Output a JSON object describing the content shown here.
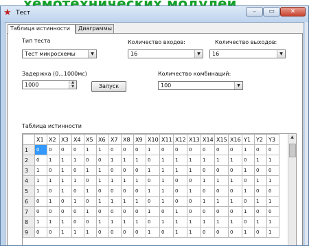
{
  "banner": {
    "text": "хемотехнических модулей"
  },
  "window": {
    "title": "Тест",
    "app_icon": "star-icon",
    "controls": {
      "minimize": "–",
      "maximize": "▭",
      "close": "✕"
    }
  },
  "tabs": [
    {
      "label": "Таблица истинности",
      "active": true
    },
    {
      "label": "Диаграммы",
      "active": false
    }
  ],
  "form": {
    "test_type_label": "Тип теста",
    "test_type_value": "Тест микросхемы",
    "inputs_label": "Количество входов:",
    "inputs_value": "16",
    "outputs_label": "Количество выходов:",
    "outputs_value": "16",
    "delay_label": "Задержка (0...1000мс)",
    "delay_value": "1000",
    "start_label": "Запуск",
    "combinations_label": "Количество комбинаций:",
    "combinations_value": "100"
  },
  "truth_table": {
    "title": "Таблица истинности",
    "columns": [
      "X1",
      "X2",
      "X3",
      "X4",
      "X5",
      "X6",
      "X7",
      "X8",
      "X9",
      "X10",
      "X11",
      "X12",
      "X13",
      "X14",
      "X15",
      "X16",
      "Y1",
      "Y2",
      "Y3"
    ],
    "rows": [
      {
        "n": "1",
        "values": [
          "0",
          "0",
          "0",
          "0",
          "1",
          "1",
          "0",
          "0",
          "0",
          "1",
          "0",
          "0",
          "0",
          "0",
          "0",
          "0",
          "1",
          "0",
          "0"
        ]
      },
      {
        "n": "2",
        "values": [
          "0",
          "1",
          "1",
          "1",
          "0",
          "0",
          "1",
          "1",
          "1",
          "0",
          "1",
          "1",
          "1",
          "1",
          "1",
          "1",
          "0",
          "1",
          "1"
        ]
      },
      {
        "n": "3",
        "values": [
          "1",
          "0",
          "1",
          "0",
          "1",
          "1",
          "0",
          "0",
          "0",
          "1",
          "1",
          "1",
          "1",
          "0",
          "0",
          "0",
          "1",
          "0",
          "0"
        ]
      },
      {
        "n": "4",
        "values": [
          "1",
          "1",
          "1",
          "1",
          "0",
          "1",
          "1",
          "1",
          "1",
          "0",
          "1",
          "0",
          "0",
          "1",
          "1",
          "1",
          "0",
          "1",
          "1"
        ]
      },
      {
        "n": "5",
        "values": [
          "1",
          "0",
          "1",
          "0",
          "1",
          "0",
          "0",
          "0",
          "0",
          "1",
          "1",
          "0",
          "1",
          "0",
          "0",
          "0",
          "1",
          "0",
          "0"
        ]
      },
      {
        "n": "6",
        "values": [
          "0",
          "1",
          "0",
          "1",
          "0",
          "1",
          "1",
          "1",
          "1",
          "0",
          "1",
          "0",
          "0",
          "1",
          "1",
          "1",
          "0",
          "1",
          "1"
        ]
      },
      {
        "n": "7",
        "values": [
          "0",
          "0",
          "0",
          "0",
          "1",
          "0",
          "0",
          "0",
          "0",
          "1",
          "0",
          "1",
          "0",
          "0",
          "0",
          "0",
          "1",
          "0",
          "0"
        ]
      },
      {
        "n": "8",
        "values": [
          "1",
          "1",
          "1",
          "0",
          "0",
          "1",
          "1",
          "1",
          "1",
          "0",
          "1",
          "1",
          "1",
          "1",
          "1",
          "1",
          "0",
          "1",
          "1"
        ]
      },
      {
        "n": "9",
        "values": [
          "0",
          "0",
          "1",
          "1",
          "1",
          "0",
          "0",
          "0",
          "0",
          "1",
          "0",
          "1",
          "1",
          "0",
          "0",
          "0",
          "1",
          "0",
          "1"
        ]
      }
    ]
  },
  "colors": {
    "selection": "#3399ff",
    "banner_text": "#16a22a",
    "window_frame": "#bcd3ec"
  }
}
